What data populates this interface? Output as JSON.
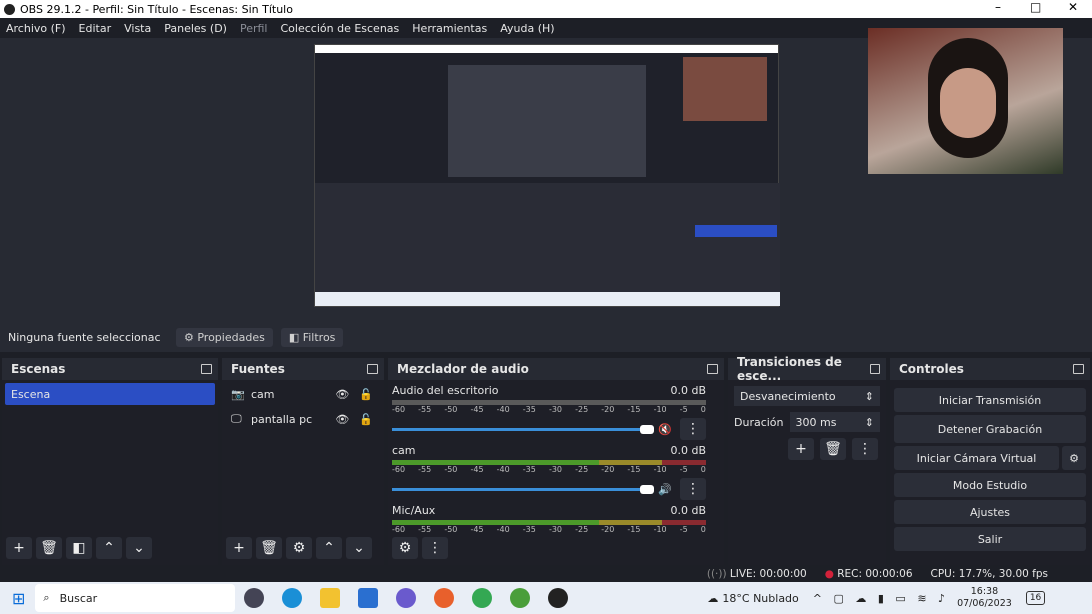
{
  "window": {
    "title": "OBS 29.1.2 - Perfil: Sin Título - Escenas: Sin Título",
    "min": "–",
    "max": "□",
    "close": "✕"
  },
  "menu": [
    "Archivo (F)",
    "Editar",
    "Vista",
    "Paneles (D)",
    "Perfil",
    "Colección de Escenas",
    "Herramientas",
    "Ayuda (H)"
  ],
  "source_toolbar": {
    "no_source": "Ninguna fuente seleccionac",
    "properties": "Propiedades",
    "filters": "Filtros"
  },
  "scenes": {
    "title": "Escenas",
    "items": [
      "Escena"
    ]
  },
  "sources": {
    "title": "Fuentes",
    "items": [
      "cam",
      "pantalla pc"
    ]
  },
  "mixer": {
    "title": "Mezclador de audio",
    "ticks": [
      "-60",
      "-55",
      "-50",
      "-45",
      "-40",
      "-35",
      "-30",
      "-25",
      "-20",
      "-15",
      "-10",
      "-5",
      "0"
    ],
    "channels": [
      {
        "name": "Audio del escritorio",
        "db": "0.0 dB",
        "muted": true
      },
      {
        "name": "cam",
        "db": "0.0 dB",
        "muted": false
      },
      {
        "name": "Mic/Aux",
        "db": "0.0 dB",
        "muted": false
      }
    ]
  },
  "transitions": {
    "title": "Transiciones de esce...",
    "type": "Desvanecimiento",
    "duration_label": "Duración",
    "duration": "300 ms"
  },
  "controls": {
    "title": "Controles",
    "buttons": [
      "Iniciar Transmisión",
      "Detener Grabación",
      "Iniciar Cámara Virtual",
      "Modo Estudio",
      "Ajustes",
      "Salir"
    ]
  },
  "status": {
    "live": "LIVE: 00:00:00",
    "rec": "REC: 00:00:06",
    "cpu": "CPU: 17.7%, 30.00 fps"
  },
  "taskbar": {
    "search": "Buscar",
    "weather": "18°C  Nublado",
    "time": "16:38",
    "date": "07/06/2023",
    "notifications": "16"
  },
  "colors": {
    "accent": "#2b4ec4",
    "rec": "#d2213a"
  }
}
